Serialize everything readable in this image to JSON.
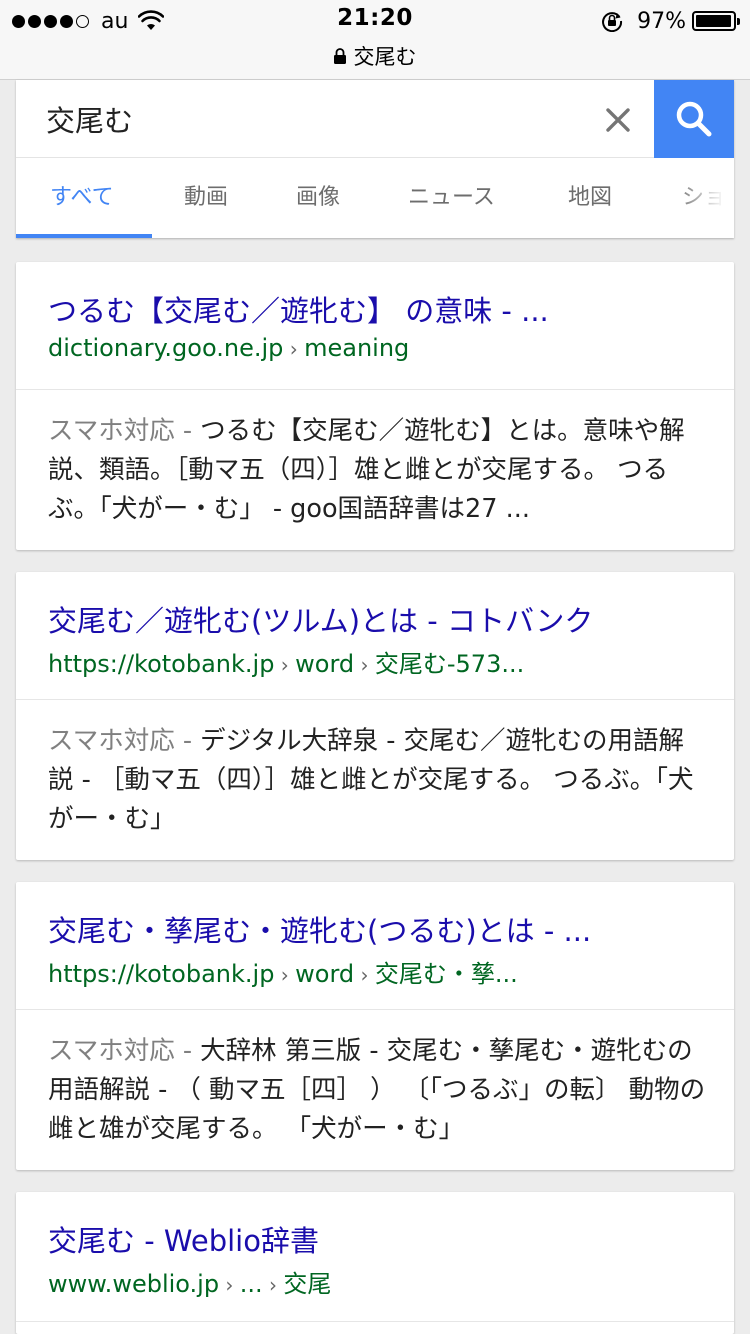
{
  "status_bar": {
    "carrier": "au",
    "time": "21:20",
    "battery": "97%",
    "battery_level": 0.97,
    "url": "交尾む"
  },
  "search": {
    "query": "交尾む",
    "clear_label": "×"
  },
  "tabs": [
    {
      "label": "すべて",
      "active": true
    },
    {
      "label": "動画"
    },
    {
      "label": "画像"
    },
    {
      "label": "ニュース"
    },
    {
      "label": "地図"
    },
    {
      "label": "ショ"
    }
  ],
  "results": [
    {
      "title": "つるむ【交尾む／遊牝む】 の意味 - ...",
      "url_parts": [
        "dictionary.goo.ne.jp",
        "meaning"
      ],
      "label": "スマホ対応 - ",
      "snippet": "つるむ【交尾む／遊牝む】とは。意味や解説、類語。［動マ五（四）］雄と雌とが交尾する。 つるぶ。「犬がー・む」 - goo国語辞書は27 ..."
    },
    {
      "title": "交尾む／遊牝む(ツルム)とは - コトバンク",
      "url_parts": [
        "https://kotobank.jp",
        "word",
        "交尾む-573..."
      ],
      "label": "スマホ対応 - ",
      "snippet": "デジタル大辞泉 - 交尾む／遊牝むの用語解説 - ［動マ五（四）］雄と雌とが交尾する。 つるぶ。「犬がー・む」"
    },
    {
      "title": "交尾む・孳尾む・遊牝む(つるむ)とは - ...",
      "url_parts": [
        "https://kotobank.jp",
        "word",
        "交尾む・孳..."
      ],
      "label": "スマホ対応 - ",
      "snippet": "大辞林 第三版 - 交尾む・孳尾む・遊牝むの用語解説 - （ 動マ五［四］ ） 〔「つるぶ」の転〕 動物の雌と雄が交尾する。 「犬がー・む」"
    },
    {
      "title": "交尾む - Weblio辞書",
      "url_parts": [
        "www.weblio.jp",
        "...",
        "交尾"
      ],
      "label": "",
      "snippet": ""
    }
  ]
}
